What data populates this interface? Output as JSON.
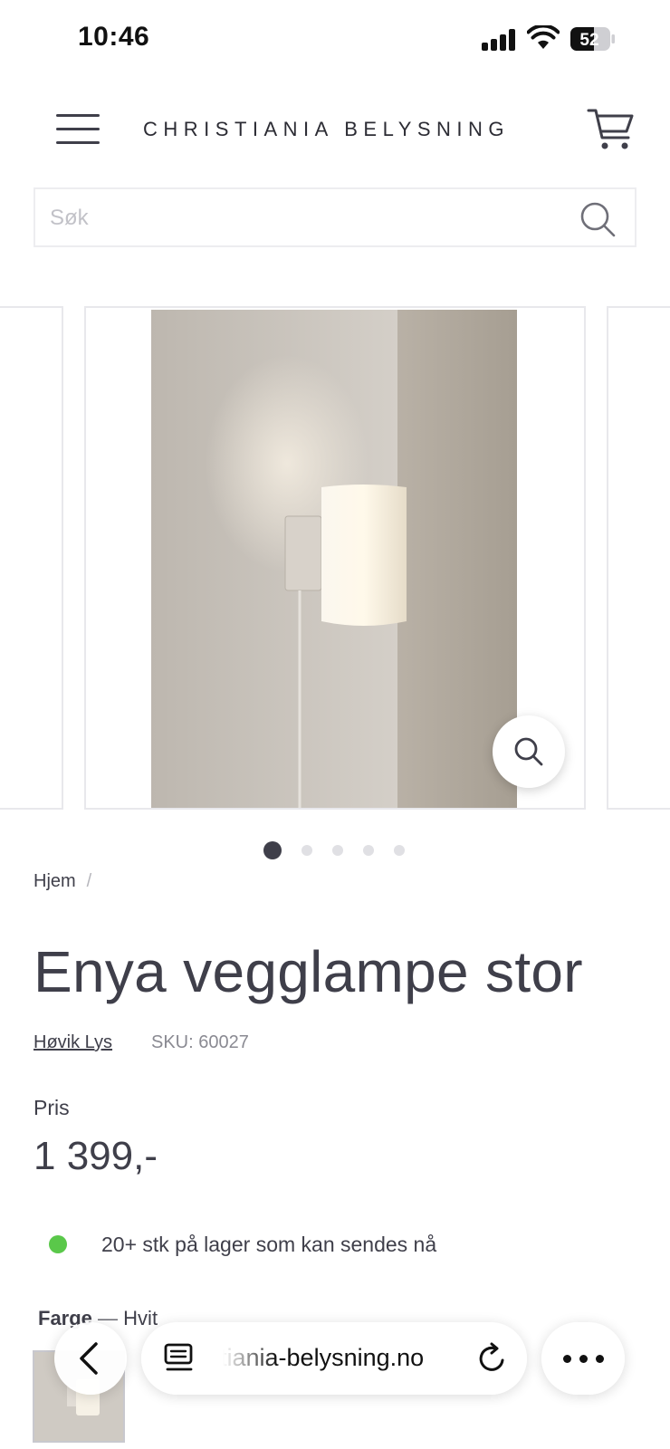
{
  "status_bar": {
    "time": "10:46",
    "battery_level": "52"
  },
  "header": {
    "brand": "CHRISTIANIA BELYSNING"
  },
  "search": {
    "placeholder": "Søk"
  },
  "carousel": {
    "slide_count": 5,
    "active_index": 0
  },
  "product": {
    "breadcrumb_home": "Hjem",
    "breadcrumb_separator": "/",
    "title": "Enya vegglampe stor",
    "brand": "Høvik Lys",
    "sku": "SKU: 60027",
    "price_label": "Pris",
    "price": "1 399,-",
    "stock_text": "20+ stk på lager som kan sendes nå",
    "stock_color": "#5ac84a",
    "color_label": "Farge",
    "color_separator": "—",
    "color_value": "Hvit"
  },
  "browser": {
    "url": "christiania-belysning.no"
  }
}
